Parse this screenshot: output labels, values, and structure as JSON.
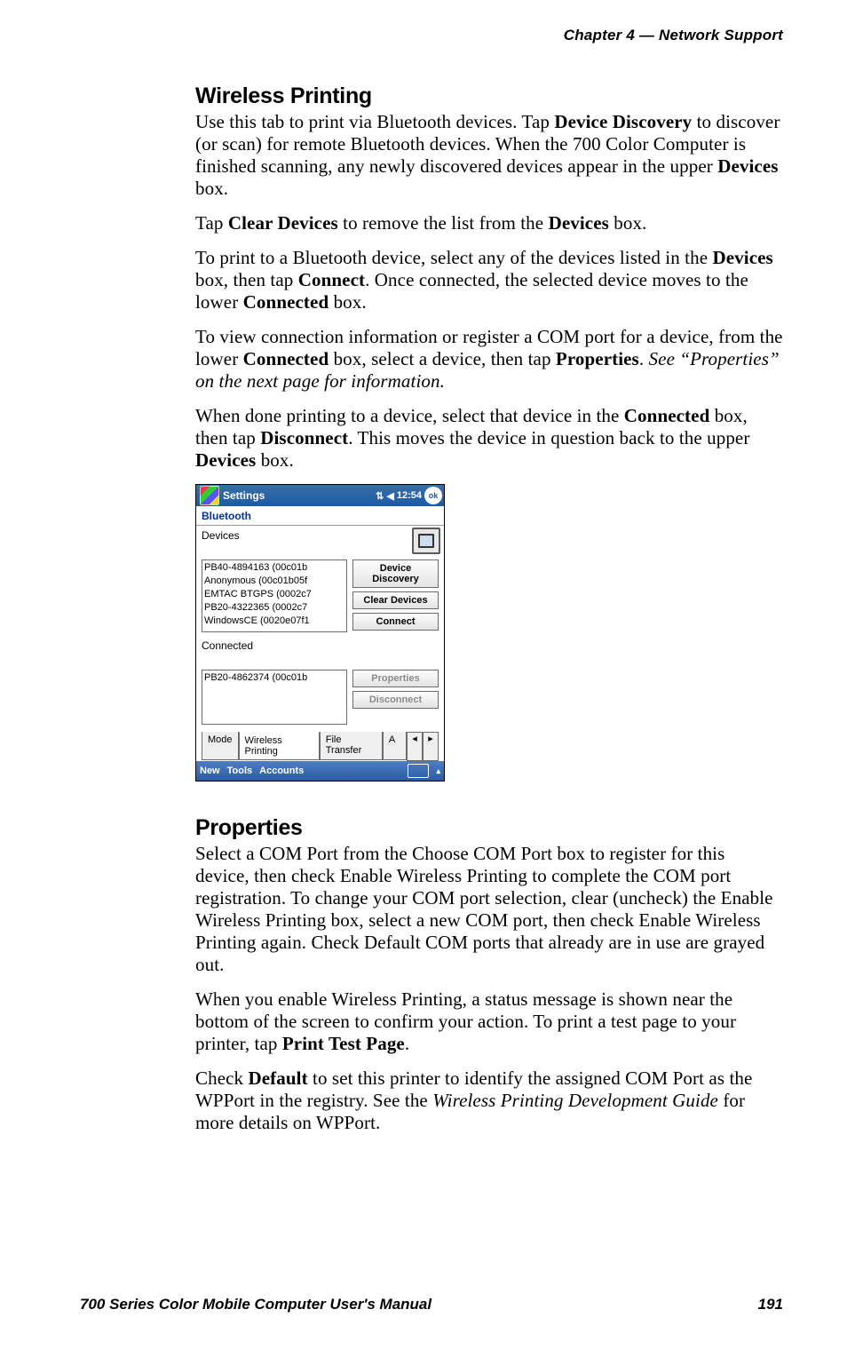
{
  "header": {
    "chapter_label": "Chapter 4 — Network Support"
  },
  "sections": {
    "wprinting": {
      "title": "Wireless Printing",
      "p1_a": "Use this tab to print via Bluetooth devices. Tap ",
      "p1_b_bold": "Device Discovery",
      "p1_c": " to discover (or scan) for remote Bluetooth devices. When the 700 Color Computer is finished scanning, any newly discovered devices appear in the upper ",
      "p1_d_bold": "Devices",
      "p1_e": " box.",
      "p2_a": "Tap ",
      "p2_b_bold": "Clear Devices",
      "p2_c": " to remove the list from the ",
      "p2_d_bold": "Devices",
      "p2_e": " box.",
      "p3_a": "To print to a Bluetooth device, select any of the devices listed in the ",
      "p3_b_bold": "Devices",
      "p3_c": " box, then tap ",
      "p3_d_bold": "Connect",
      "p3_e": ". Once connected, the selected device moves to the lower ",
      "p3_f_bold": "Connected",
      "p3_g": " box.",
      "p4_a": "To view connection information or register a COM port for a device, from the lower ",
      "p4_b_bold": "Connected",
      "p4_c": " box, select a device, then tap ",
      "p4_d_bold": "Properties",
      "p4_e": ". ",
      "p4_f_italic": "See “Properties” on the next page for information.",
      "p5_a": "When done printing to a device, select that device in the ",
      "p5_b_bold": "Connected",
      "p5_c": " box, then tap ",
      "p5_d_bold": "Disconnect",
      "p5_e": ". This moves the device in question back to the upper ",
      "p5_f_bold": "Devices",
      "p5_g": " box."
    },
    "properties": {
      "title": "Properties",
      "p1": "Select a COM Port from the Choose COM Port box to register for this device, then check Enable Wireless Printing to complete the COM port registration. To change your COM port selection, clear (uncheck) the Enable Wireless Printing box, select a new COM port, then check Enable Wireless Printing again. Check Default COM ports that already are in use are grayed out.",
      "p2_a": "When you enable Wireless Printing, a status message is shown near the bottom of the screen to confirm your action. To print a test page to your printer, tap ",
      "p2_b_bold": "Print Test Page",
      "p2_c": ".",
      "p3_a": "Check ",
      "p3_b_bold": "Default",
      "p3_c": " to set this printer to identify the assigned COM Port as the WPPort in the registry. See the ",
      "p3_d_italic": "Wireless Printing Development Guide",
      "p3_e": " for more details on WPPort."
    }
  },
  "screenshot": {
    "titlebar": {
      "app": "Settings",
      "time": "12:54",
      "ok": "ok"
    },
    "screen_title": "Bluetooth",
    "devices_label": "Devices",
    "devices": [
      "PB40-4894163 (00c01b",
      "Anonymous (00c01b05f",
      "EMTAC BTGPS (0002c7",
      "PB20-4322365 (0002c7",
      "WindowsCE (0020e07f1"
    ],
    "connected_label": "Connected",
    "connected": [
      "PB20-4862374 (00c01b"
    ],
    "buttons": {
      "discovery_l1": "Device",
      "discovery_l2": "Discovery",
      "clear": "Clear Devices",
      "connect": "Connect",
      "properties": "Properties",
      "disconnect": "Disconnect"
    },
    "tabs": {
      "mode": "Mode",
      "wp": "Wireless Printing",
      "ft": "File Transfer",
      "more": "A"
    },
    "menubar": {
      "new": "New",
      "tools": "Tools",
      "accounts": "Accounts"
    }
  },
  "footer": {
    "manual": "700 Series Color Mobile Computer User's Manual",
    "page": "191"
  }
}
